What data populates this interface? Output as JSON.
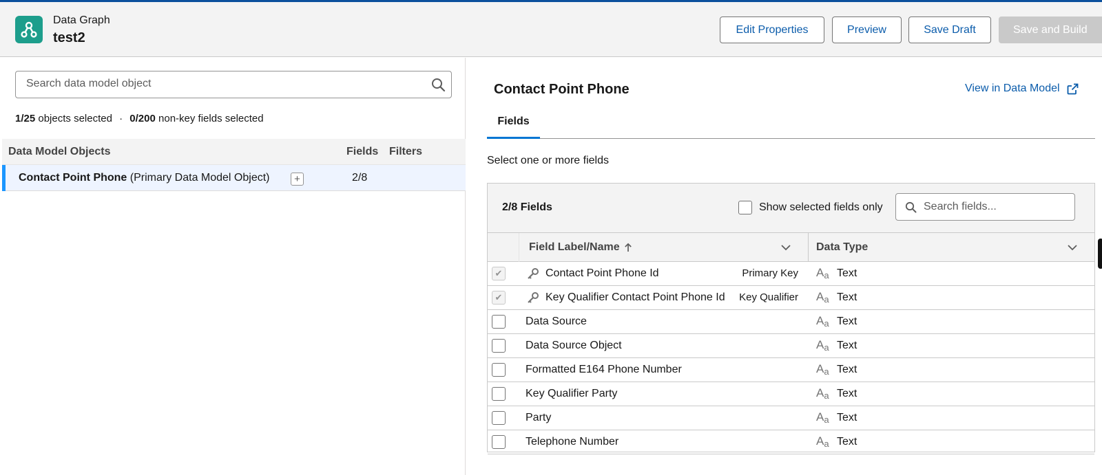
{
  "header": {
    "subtitle": "Data Graph",
    "title": "test2",
    "buttons": {
      "edit": "Edit Properties",
      "preview": "Preview",
      "save_draft": "Save Draft",
      "save_build": "Save and Build"
    }
  },
  "left": {
    "search_placeholder": "Search data model object",
    "selection": {
      "objects_count": "1/25",
      "objects_text": "objects selected",
      "separator": "·",
      "fields_count": "0/200",
      "fields_text": "non-key fields selected"
    },
    "table": {
      "col_objects": "Data Model Objects",
      "col_fields": "Fields",
      "col_filters": "Filters",
      "rows": [
        {
          "name": "Contact Point Phone",
          "qualifier": "(Primary Data Model Object)",
          "fields": "2/8",
          "filters": ""
        }
      ]
    }
  },
  "right": {
    "object_title": "Contact Point Phone",
    "view_link": "View in Data Model",
    "tab": "Fields",
    "instruction": "Select one or more fields",
    "panel": {
      "count": "2/8 Fields",
      "show_selected_label": "Show selected fields only",
      "search_placeholder": "Search fields...",
      "col_label": "Field Label/Name",
      "col_type": "Data Type",
      "rows": [
        {
          "label": "Contact Point Phone Id",
          "role": "Primary Key",
          "type": "Text",
          "checked": true,
          "disabled": true,
          "key": true
        },
        {
          "label": "Key Qualifier Contact Point Phone Id",
          "role": "Key Qualifier",
          "type": "Text",
          "checked": true,
          "disabled": true,
          "key": true
        },
        {
          "label": "Data Source",
          "role": "",
          "type": "Text",
          "checked": false,
          "disabled": false,
          "key": false
        },
        {
          "label": "Data Source Object",
          "role": "",
          "type": "Text",
          "checked": false,
          "disabled": false,
          "key": false
        },
        {
          "label": "Formatted E164 Phone Number",
          "role": "",
          "type": "Text",
          "checked": false,
          "disabled": false,
          "key": false
        },
        {
          "label": "Key Qualifier Party",
          "role": "",
          "type": "Text",
          "checked": false,
          "disabled": false,
          "key": false
        },
        {
          "label": "Party",
          "role": "",
          "type": "Text",
          "checked": false,
          "disabled": false,
          "key": false
        },
        {
          "label": "Telephone Number",
          "role": "",
          "type": "Text",
          "checked": false,
          "disabled": false,
          "key": false
        }
      ]
    }
  },
  "colors": {
    "app_icon": "#1d9e8c",
    "link": "#0b5cab",
    "tab_accent": "#0176d3",
    "row_selected": "#eef4ff",
    "row_accent": "#1b96ff"
  },
  "icons": {
    "app": "data-graph-icon",
    "search": "search-icon",
    "external": "external-link-icon",
    "key": "key-icon",
    "text_type": "text-type-icon",
    "sort": "sort-arrow-up-icon",
    "chevron": "chevron-down-icon"
  }
}
